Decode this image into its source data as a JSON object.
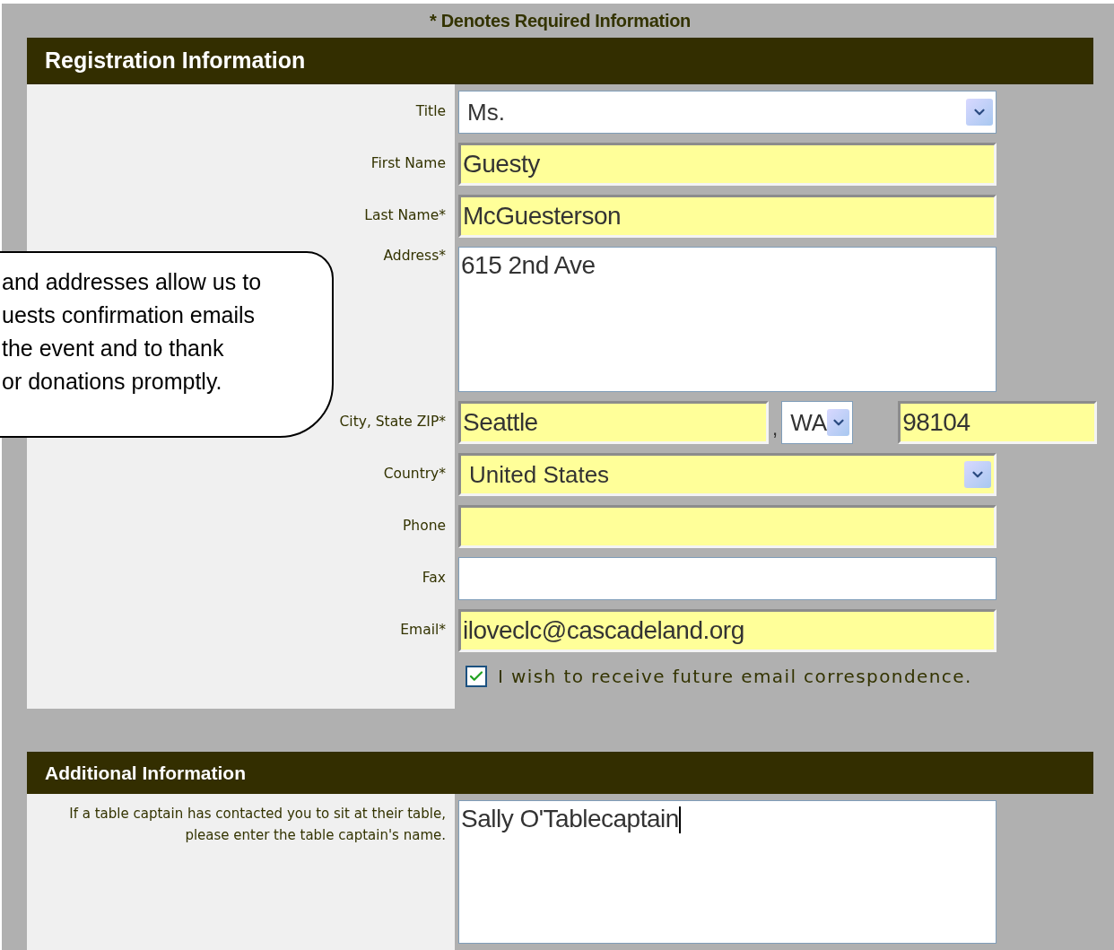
{
  "required_note": "* Denotes Required Information",
  "callout": {
    "lines": [
      "and addresses allow us to",
      "uests confirmation emails",
      "the event and to thank",
      "or donations promptly."
    ]
  },
  "sections": [
    {
      "title": "Registration Information",
      "rows": [
        {
          "label": "Title",
          "kind": "select",
          "value": "Ms.",
          "autofilled": false
        },
        {
          "label": "First Name",
          "kind": "text",
          "value": "Guesty",
          "autofilled": true
        },
        {
          "label": "Last Name*",
          "kind": "text",
          "value": "McGuesterson",
          "autofilled": true
        },
        {
          "label": "Address*",
          "kind": "textarea",
          "value": "615 2nd Ave",
          "autofilled": false
        },
        {
          "label": "City, State ZIP*",
          "kind": "group",
          "separator": ",",
          "fields": [
            {
              "kind": "text",
              "value": "Seattle",
              "autofilled": true
            },
            {
              "kind": "select",
              "value": "WA",
              "autofilled": false
            },
            {
              "kind": "text",
              "value": "98104",
              "autofilled": true
            }
          ]
        },
        {
          "label": "Country*",
          "kind": "select",
          "value": "United States",
          "autofilled": true
        },
        {
          "label": "Phone",
          "kind": "text",
          "autofilled": true
        },
        {
          "label": "Fax",
          "kind": "text",
          "autofilled": false
        },
        {
          "label": "Email*",
          "kind": "text",
          "value": "iloveclc@cascadeland.org",
          "autofilled": true
        },
        {
          "kind": "checkbox",
          "text": "I wish to receive future email correspondence.",
          "checked": true
        }
      ]
    },
    {
      "title": "Additional Information",
      "rows": [
        {
          "label": "If a table captain has contacted you to sit at their table, please enter the table captain's name.",
          "kind": "textarea",
          "value": "Sally O'Tablecaptain",
          "autofilled": false,
          "focused": true
        }
      ]
    }
  ]
}
